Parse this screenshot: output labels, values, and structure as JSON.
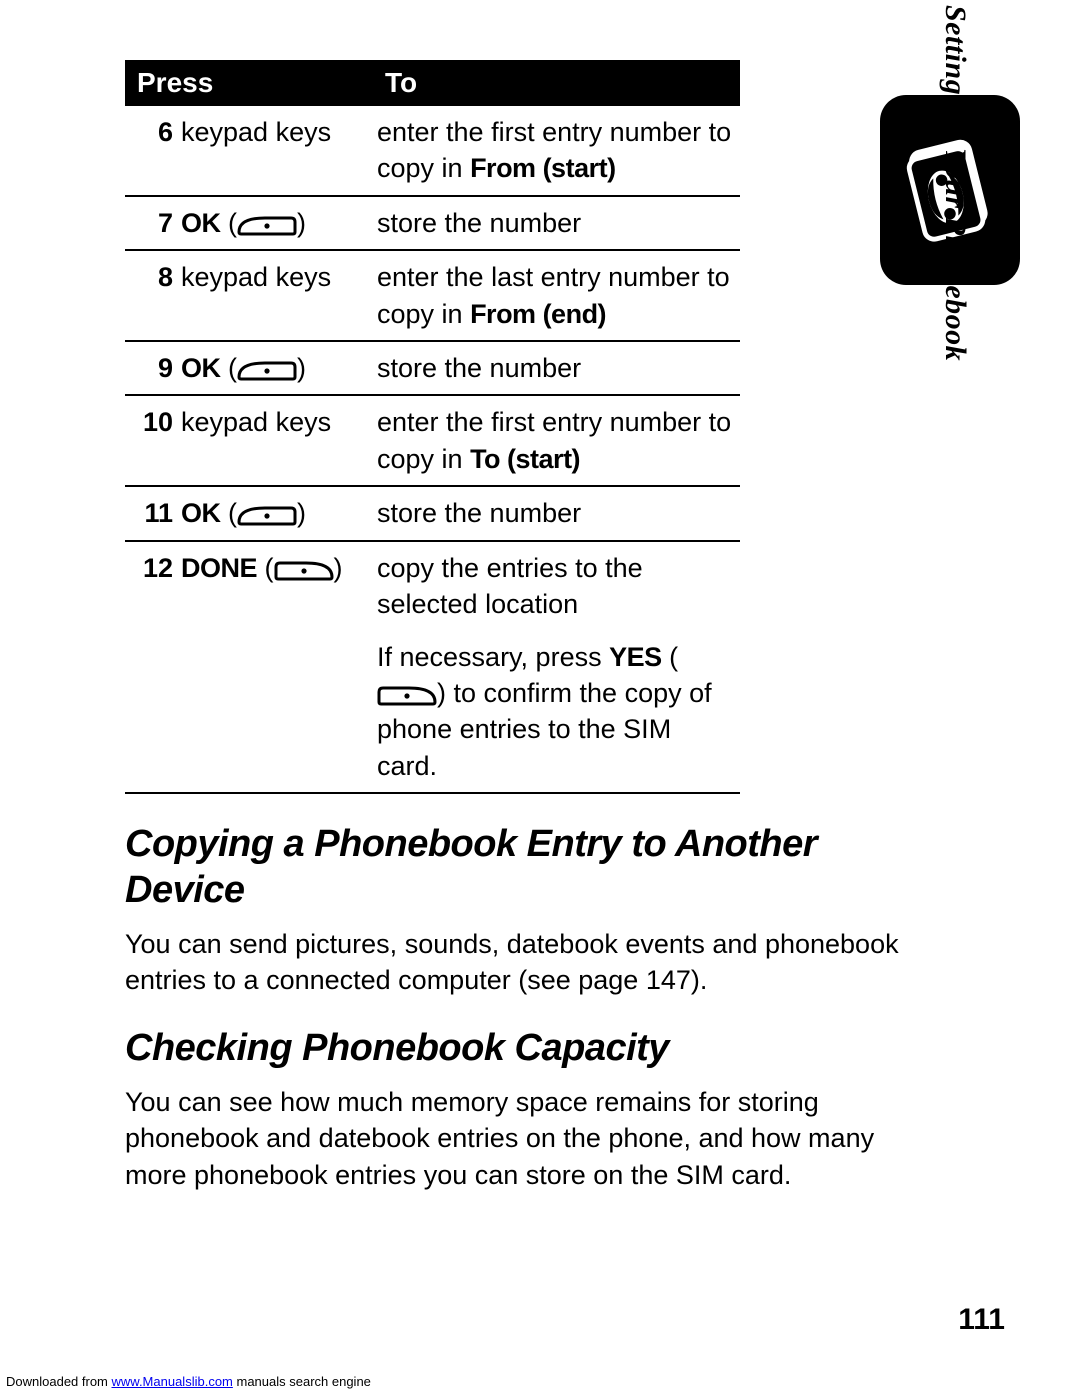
{
  "table": {
    "headers": {
      "press": "Press",
      "to": "To"
    },
    "rows": [
      {
        "num": "6",
        "press_plain": "keypad keys",
        "press_label": "",
        "to_pre": "enter the first entry number to copy in ",
        "to_cond": "From (start)",
        "to_post": ""
      },
      {
        "num": "7",
        "press_plain": "",
        "press_label": "OK",
        "press_soft": "left",
        "to_pre": "store the number",
        "to_cond": "",
        "to_post": ""
      },
      {
        "num": "8",
        "press_plain": "keypad keys",
        "press_label": "",
        "to_pre": "enter the last entry number to copy in ",
        "to_cond": "From (end)",
        "to_post": ""
      },
      {
        "num": "9",
        "press_plain": "",
        "press_label": "OK",
        "press_soft": "left",
        "to_pre": "store the number",
        "to_cond": "",
        "to_post": ""
      },
      {
        "num": "10",
        "press_plain": "keypad keys",
        "press_label": "",
        "to_pre": "enter the first entry number to copy in ",
        "to_cond": "To (start)",
        "to_post": ""
      },
      {
        "num": "11",
        "press_plain": "",
        "press_label": "OK",
        "press_soft": "left",
        "to_pre": "store the number",
        "to_cond": "",
        "to_post": ""
      },
      {
        "num": "12",
        "press_plain": "",
        "press_label": "DONE",
        "press_soft": "right",
        "to_pre": "copy the entries to the selected location",
        "to_cond": "",
        "to_post": ""
      }
    ],
    "extra": {
      "pre": "If necessary, press ",
      "yes": "YES",
      "mid": " (",
      "post": ") to confirm the copy of phone entries to the SIM card."
    }
  },
  "heading1": "Copying a Phonebook Entry to Another Device",
  "para1": "You can send pictures, sounds, datebook events and phonebook entries to a connected computer (see page 147).",
  "heading2": "Checking Phonebook Capacity",
  "para2": "You can see how much memory space remains for storing phonebook and datebook entries on the phone, and how many more phonebook entries you can store on the SIM card.",
  "side_label": "Setting Up Your Phonebook",
  "page_number": "111",
  "footer": {
    "pre": "Downloaded from ",
    "link_text": "www.Manualslib.com",
    "post": " manuals search engine"
  }
}
